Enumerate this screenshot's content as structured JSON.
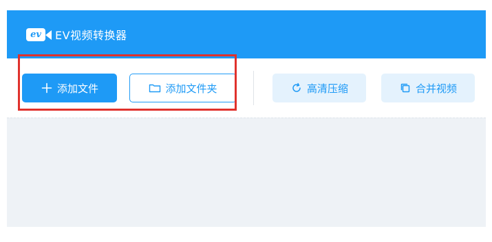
{
  "app": {
    "logo_text": "ev",
    "title": "EV视频转换器"
  },
  "toolbar": {
    "add_file_label": "添加文件",
    "add_folder_label": "添加文件夹",
    "hd_compress_label": "高清压缩",
    "merge_video_label": "合并视频"
  },
  "icons": {
    "add_file": "plus-icon",
    "add_folder": "folder-icon",
    "hd_compress": "refresh-icon",
    "merge_video": "copy-icon"
  },
  "colors": {
    "brand": "#1e9af6",
    "light_button": "#e4f2fd",
    "content_bg": "#eef2f6",
    "highlight": "#e0312c"
  }
}
